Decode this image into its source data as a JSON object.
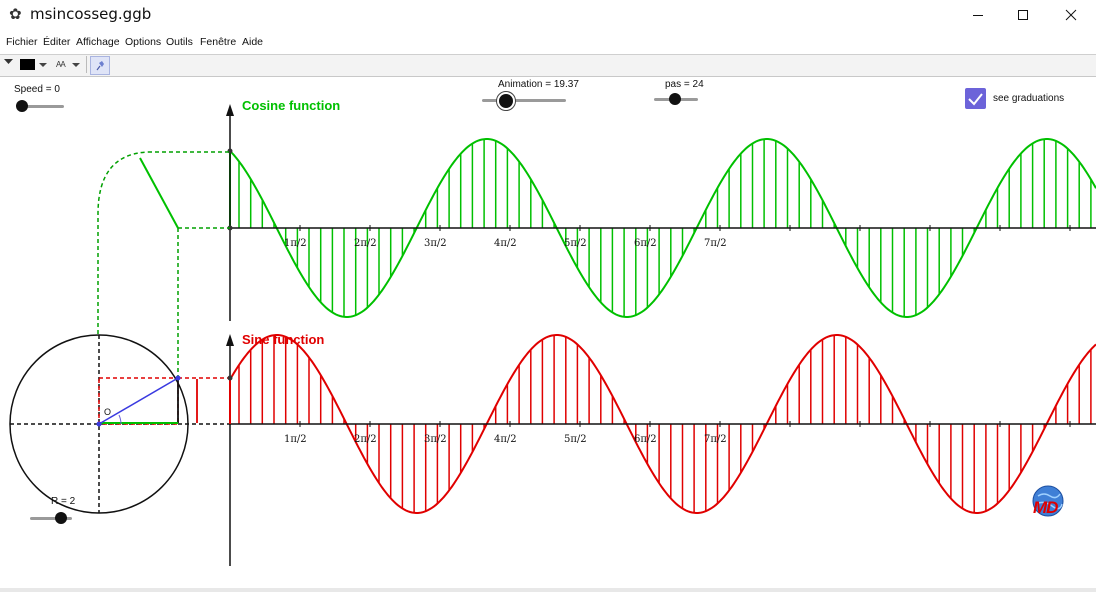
{
  "window": {
    "title": "msincosseg.ggb",
    "app_icon": "✿"
  },
  "menu": [
    "Fichier",
    "Éditer",
    "Affichage",
    "Options",
    "Outils",
    "Fenêtre",
    "Aide"
  ],
  "toolbar": {
    "font_size_glyph": "AA",
    "style_menu_icon": "triangle-down-icon",
    "pin_icon": "pin-icon"
  },
  "sliders": {
    "speed": {
      "label": "Speed = 0",
      "value": 0
    },
    "animation": {
      "label": "Animation = 19.37",
      "value": 19.37
    },
    "pas": {
      "label": "pas = 24",
      "value": 24
    },
    "radius": {
      "label": "R = 2",
      "value": 2
    }
  },
  "checkbox": {
    "label": "see graduations",
    "checked": true
  },
  "graphs": {
    "cosine": {
      "title": "Cosine function",
      "color": "#00c000"
    },
    "sine": {
      "title": "Sine function",
      "color": "#e00000"
    }
  },
  "tick_labels": [
    "1π/2",
    "2π/2",
    "3π/2",
    "4π/2",
    "5π/2",
    "6π/2",
    "7π/2"
  ],
  "circle": {
    "origin_label": "O"
  },
  "logo": {
    "text": "MD"
  },
  "colors": {
    "accent": "#6c63d9",
    "radius_line": "#3a3ae0"
  }
}
